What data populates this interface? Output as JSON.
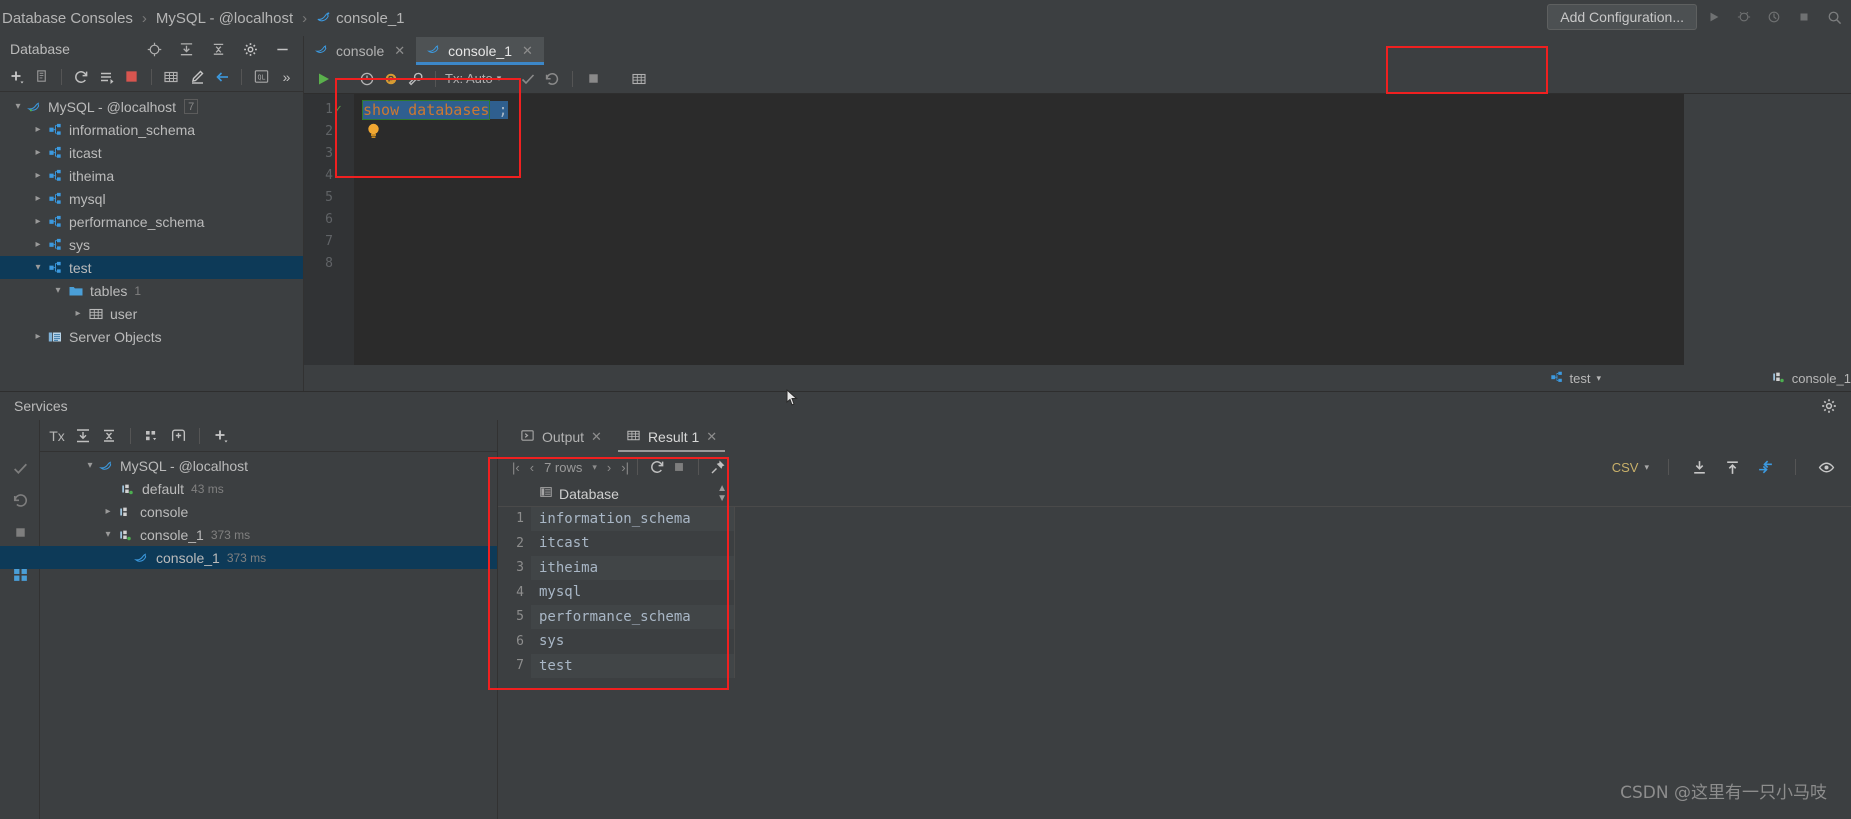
{
  "breadcrumb": {
    "items": [
      {
        "label": "Database Consoles",
        "icon": "none"
      },
      {
        "label": "MySQL - @localhost",
        "icon": "none"
      },
      {
        "label": "console_1",
        "icon": "mysql-dolphin-icon"
      }
    ],
    "separator": "›"
  },
  "top_toolbar": {
    "add_configuration_label": "Add Configuration...",
    "icons": [
      "run-icon",
      "debug-icon",
      "profile-icon",
      "stop-icon",
      "search-icon"
    ]
  },
  "sidebar": {
    "title": "Database",
    "header_icons": [
      "locate-icon",
      "expand-all-icon",
      "collapse-all-icon",
      "gear-icon",
      "minimize-icon"
    ],
    "toolbar_icons": [
      "add-icon",
      "copy-icon",
      "refresh-icon",
      "sync-icon",
      "stop-icon",
      "table-icon",
      "edit-icon",
      "jump-to-icon",
      "query-console-icon",
      "more-icon"
    ],
    "tree": [
      {
        "label": "MySQL - @localhost",
        "icon": "mysql-dolphin-icon",
        "twisty": "expanded",
        "indent": 0,
        "badge": "7",
        "selected": false
      },
      {
        "label": "information_schema",
        "icon": "schema-icon",
        "twisty": "collapsed",
        "indent": 1,
        "selected": false
      },
      {
        "label": "itcast",
        "icon": "schema-icon",
        "twisty": "collapsed",
        "indent": 1,
        "selected": false
      },
      {
        "label": "itheima",
        "icon": "schema-icon",
        "twisty": "collapsed",
        "indent": 1,
        "selected": false
      },
      {
        "label": "mysql",
        "icon": "schema-icon",
        "twisty": "collapsed",
        "indent": 1,
        "selected": false
      },
      {
        "label": "performance_schema",
        "icon": "schema-icon",
        "twisty": "collapsed",
        "indent": 1,
        "selected": false
      },
      {
        "label": "sys",
        "icon": "schema-icon",
        "twisty": "collapsed",
        "indent": 1,
        "selected": false
      },
      {
        "label": "test",
        "icon": "schema-icon",
        "twisty": "expanded",
        "indent": 1,
        "selected": true
      },
      {
        "label": "tables",
        "icon": "folder-icon",
        "twisty": "expanded",
        "indent": 2,
        "count": "1",
        "selected": false
      },
      {
        "label": "user",
        "icon": "table-icon",
        "twisty": "collapsed",
        "indent": 3,
        "selected": false
      },
      {
        "label": "Server Objects",
        "icon": "server-objects-icon",
        "twisty": "collapsed",
        "indent": 1,
        "selected": false
      }
    ]
  },
  "editor": {
    "tabs": [
      {
        "label": "console",
        "icon": "mysql-dolphin-icon",
        "active": false,
        "closable": true
      },
      {
        "label": "console_1",
        "icon": "mysql-dolphin-icon",
        "active": true,
        "closable": true
      }
    ],
    "toolbar": {
      "run_label": "run-icon",
      "icons": [
        "run-icon",
        "stop-on-error-icon",
        "transaction-icon",
        "wrench-icon",
        "commit-icon",
        "rollback-icon",
        "cancel-icon",
        "data-source-icon"
      ],
      "tx_mode": "Tx: Auto"
    },
    "gutter_lines": [
      "1",
      "2",
      "3",
      "4",
      "5",
      "6",
      "7",
      "8"
    ],
    "code": {
      "keyword": "show databases",
      "semicolon": ";",
      "full_line": "show databases ;",
      "selected": true
    },
    "right_status": {
      "schema": "test",
      "schema_icon": "schema-icon",
      "session": "console_1",
      "session_icon": "session-icon"
    }
  },
  "services": {
    "title": "Services",
    "rail_icons": [
      "tx-icon",
      "expand-all-icon",
      "collapse-all-icon",
      "group-icon",
      "new-tab-icon",
      "add-icon"
    ],
    "side_rail_icons": [
      "tx-icon",
      "commit-icon",
      "rollback-icon",
      "stop-icon",
      "layout-icon"
    ],
    "tree": [
      {
        "label": "MySQL - @localhost",
        "icon": "mysql-dolphin-icon",
        "twisty": "expanded",
        "indent": 0,
        "time": "",
        "selected": false
      },
      {
        "label": "default",
        "icon": "session-icon",
        "twisty": "none",
        "indent": 1,
        "time": "43 ms",
        "selected": false
      },
      {
        "label": "console",
        "icon": "session-icon",
        "twisty": "collapsed",
        "indent": 1,
        "time": "",
        "selected": false
      },
      {
        "label": "console_1",
        "icon": "session-icon",
        "twisty": "expanded",
        "indent": 1,
        "time": "373 ms",
        "selected": false
      },
      {
        "label": "console_1",
        "icon": "mysql-dolphin-icon",
        "twisty": "none",
        "indent": 2,
        "time": "373 ms",
        "selected": true
      }
    ]
  },
  "results": {
    "tabs": [
      {
        "label": "Output",
        "icon": "output-icon",
        "active": false,
        "closable": true
      },
      {
        "label": "Result 1",
        "icon": "table-icon",
        "active": true,
        "closable": true
      }
    ],
    "pager": {
      "first": "|‹",
      "prev": "‹",
      "rows_label": "7 rows",
      "next": "›",
      "last": "›|",
      "reload_icon": "refresh-icon",
      "stop_icon": "stop-icon",
      "pin_icon": "pin-icon"
    },
    "export": {
      "format": "CSV",
      "icons": [
        "download-icon",
        "upload-icon",
        "compare-icon",
        "view-icon"
      ]
    },
    "grid": {
      "columns": [
        "Database"
      ],
      "column_icon": "column-icon",
      "rows": [
        {
          "n": "1",
          "Database": "information_schema"
        },
        {
          "n": "2",
          "Database": "itcast"
        },
        {
          "n": "3",
          "Database": "itheima"
        },
        {
          "n": "4",
          "Database": "mysql"
        },
        {
          "n": "5",
          "Database": "performance_schema"
        },
        {
          "n": "6",
          "Database": "sys"
        },
        {
          "n": "7",
          "Database": "test"
        }
      ]
    }
  },
  "watermark": "CSDN @这里有一只小马吱",
  "colors": {
    "accent_blue": "#3c87c8",
    "selection_blue": "#2f5f8f",
    "tree_selected": "#0d3a58",
    "keyword_orange": "#cc7832",
    "annotation_red": "#f02020",
    "panel_bg": "#3c3f41",
    "editor_bg": "#2b2b2b"
  }
}
